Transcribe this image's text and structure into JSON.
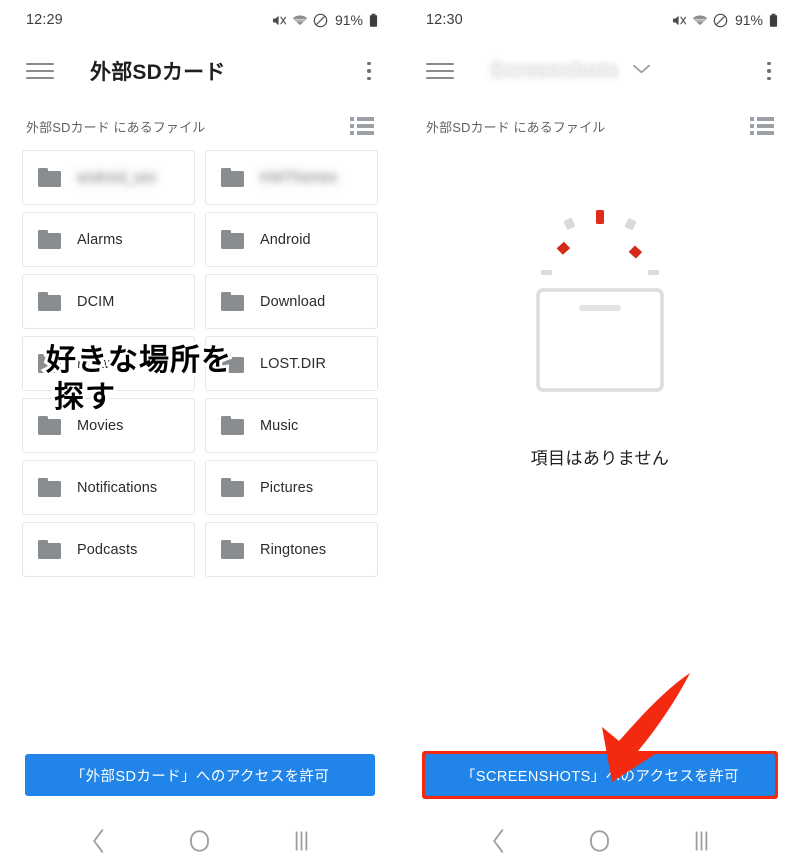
{
  "colors": {
    "primary_blue": "#2084e8",
    "annotation_red": "#f42a10",
    "folder_grey": "#8a8d90",
    "text_dark": "#202124",
    "subtitle_grey": "#5f6368"
  },
  "left_screen": {
    "status_bar": {
      "time": "12:29",
      "battery_percent": "91%",
      "icons": [
        "mute-icon",
        "wifi-icon",
        "do-not-disturb-icon",
        "battery-icon"
      ]
    },
    "app_bar": {
      "menu_icon": "hamburger-icon",
      "title": "外部SDカード",
      "title_blurred": false,
      "has_chevron": false,
      "overflow_icon": "kebab-menu-icon"
    },
    "subtitle": "外部SDカード にあるファイル",
    "view_toggle_icon": "list-view-icon",
    "folders": [
      {
        "label": "android_sec",
        "blurred": true
      },
      {
        "label": "HWThemes",
        "blurred": true
      },
      {
        "label": "Alarms",
        "blurred": false
      },
      {
        "label": "Android",
        "blurred": false
      },
      {
        "label": "DCIM",
        "blurred": false
      },
      {
        "label": "Download",
        "blurred": false
      },
      {
        "label": "Huawei",
        "blurred": false
      },
      {
        "label": "LOST.DIR",
        "blurred": false
      },
      {
        "label": "Movies",
        "blurred": false
      },
      {
        "label": "Music",
        "blurred": false
      },
      {
        "label": "Notifications",
        "blurred": false
      },
      {
        "label": "Pictures",
        "blurred": false
      },
      {
        "label": "Podcasts",
        "blurred": false
      },
      {
        "label": "Ringtones",
        "blurred": false
      }
    ],
    "annotation": {
      "line1": "好きな場所を",
      "line2": "探す"
    },
    "permission_button": {
      "label": "「外部SDカード」へのアクセスを許可",
      "highlighted": false
    },
    "nav_bar": {
      "back_icon": "back-chevron-icon",
      "home_icon": "home-circle-icon",
      "recents_icon": "recents-bars-icon"
    }
  },
  "right_screen": {
    "status_bar": {
      "time": "12:30",
      "battery_percent": "91%",
      "icons": [
        "mute-icon",
        "wifi-icon",
        "do-not-disturb-icon",
        "battery-icon"
      ]
    },
    "app_bar": {
      "menu_icon": "hamburger-icon",
      "title": "Screenshots",
      "title_blurred": true,
      "has_chevron": true,
      "chevron_icon": "chevron-down-icon",
      "overflow_icon": "kebab-menu-icon"
    },
    "subtitle": "外部SDカード にあるファイル",
    "view_toggle_icon": "list-view-icon",
    "empty_state": {
      "illustration": "empty-box-icon",
      "message": "項目はありません"
    },
    "permission_button": {
      "label": "「SCREENSHOTS」へのアクセスを許可",
      "highlighted": true
    },
    "arrow_annotation": "red-arrow-icon",
    "nav_bar": {
      "back_icon": "back-chevron-icon",
      "home_icon": "home-circle-icon",
      "recents_icon": "recents-bars-icon"
    }
  }
}
